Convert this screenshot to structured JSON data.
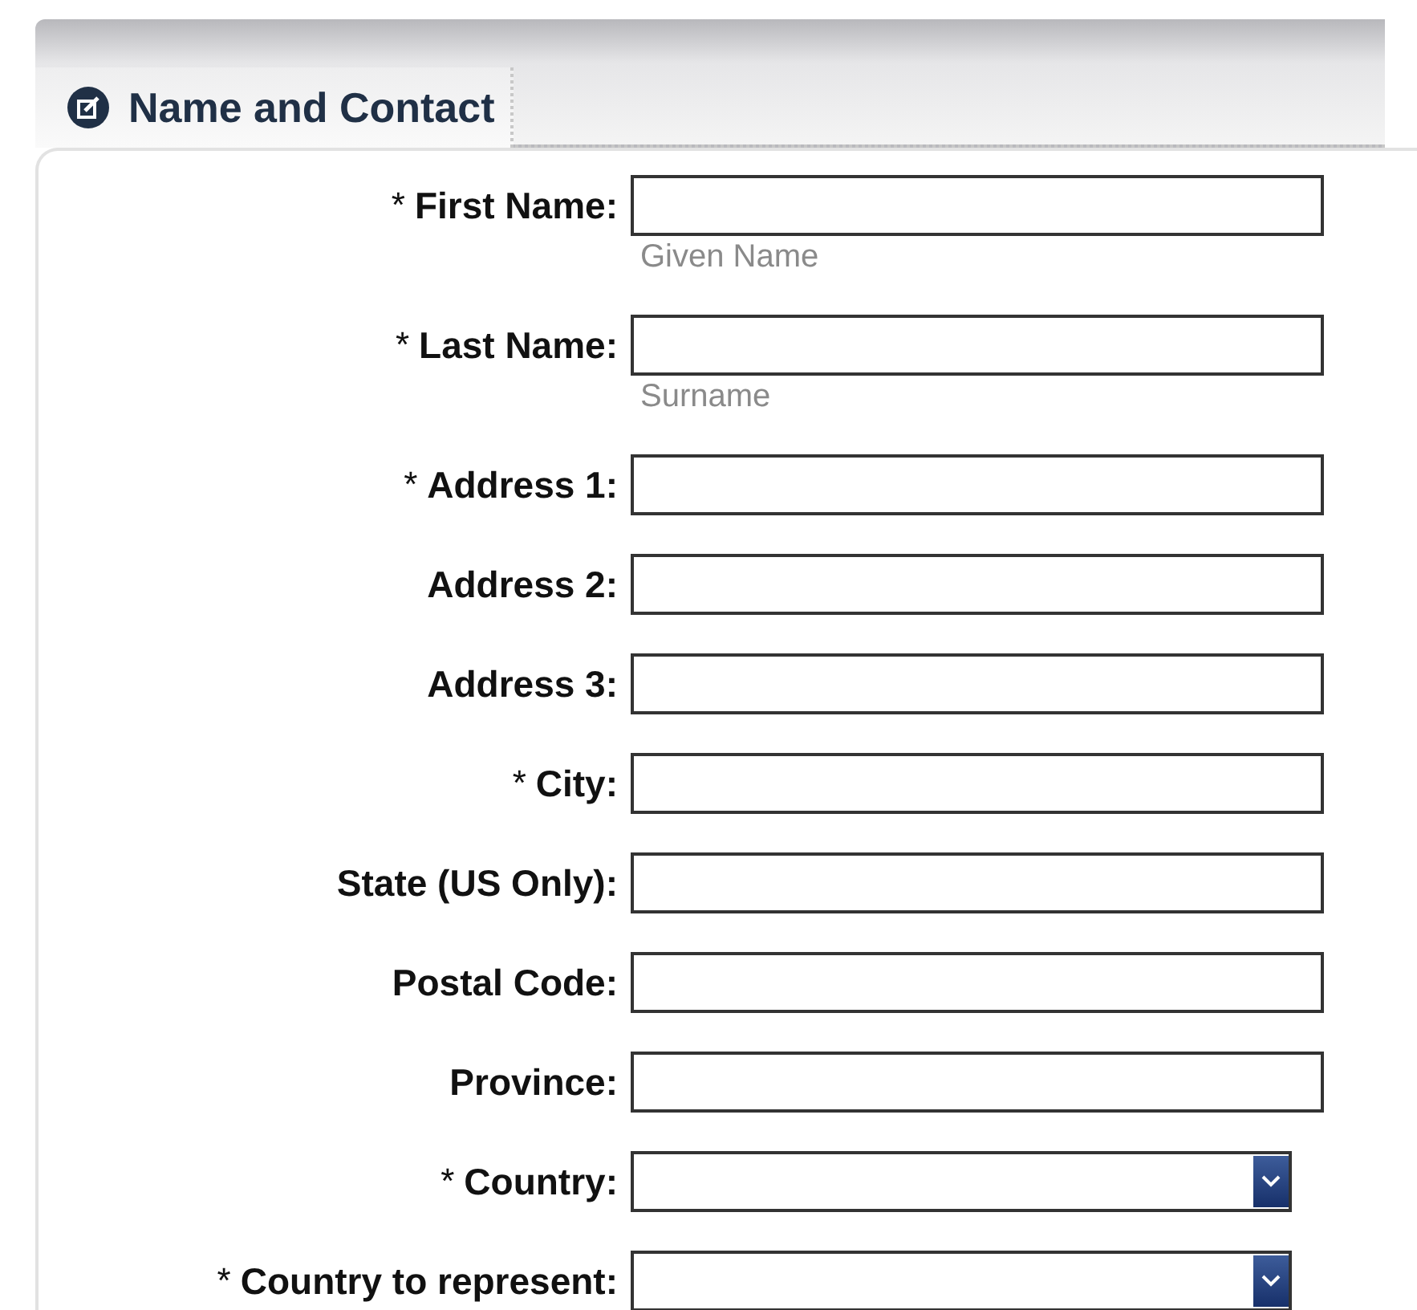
{
  "tab": {
    "title": "Name and Contact",
    "selected": true
  },
  "fields": [
    {
      "kind": "text",
      "asterisk": "*",
      "label": "First Name:",
      "hint": "Given Name"
    },
    {
      "kind": "text",
      "asterisk": "*",
      "label": "Last Name:",
      "hint": "Surname"
    },
    {
      "kind": "text",
      "asterisk": "*",
      "label": "Address 1:"
    },
    {
      "kind": "text",
      "label": "Address 2:"
    },
    {
      "kind": "text",
      "label": "Address 3:"
    },
    {
      "kind": "text",
      "asterisk": "*",
      "label": "City:"
    },
    {
      "kind": "text",
      "label": "State (US Only):"
    },
    {
      "kind": "text",
      "label": "Postal Code:"
    },
    {
      "kind": "text",
      "label": "Province:"
    },
    {
      "kind": "select",
      "asterisk": "*",
      "label": "Country:"
    },
    {
      "kind": "select",
      "asterisk": "*",
      "label": "Country to represent:"
    }
  ]
}
